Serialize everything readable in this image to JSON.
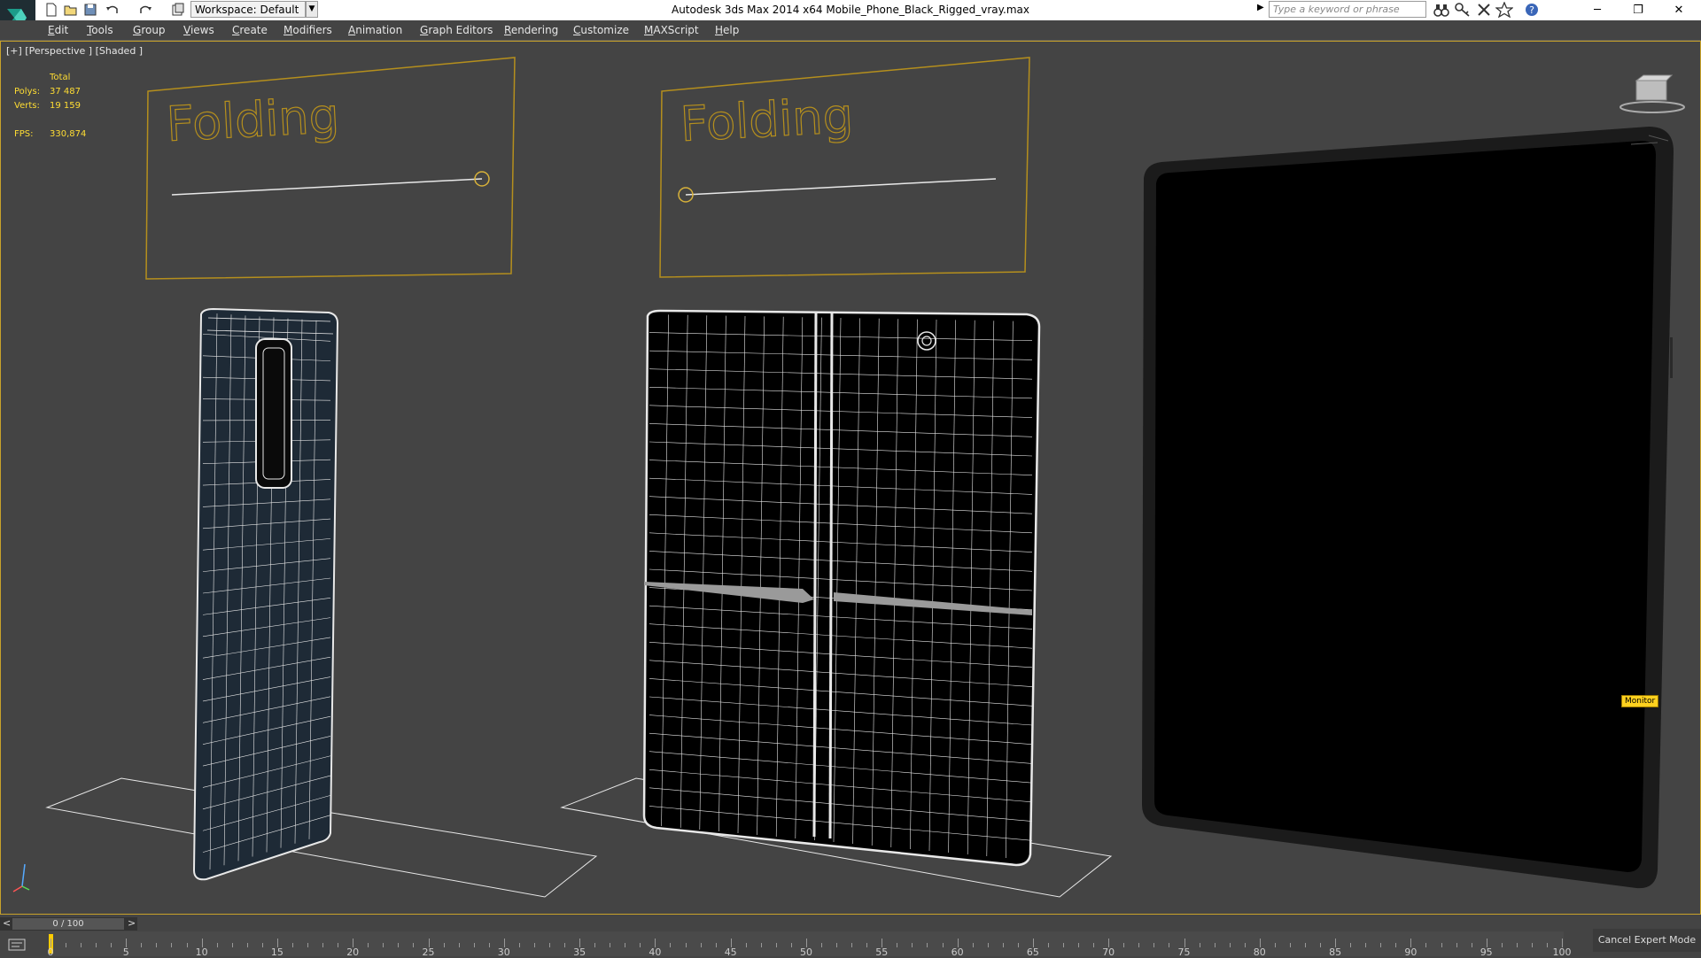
{
  "window": {
    "title": "Autodesk 3ds Max  2014 x64     Mobile_Phone_Black_Rigged_vray.max",
    "workspace": "Workspace: Default",
    "search_placeholder": "Type a keyword or phrase"
  },
  "menu": {
    "items": [
      "Edit",
      "Tools",
      "Group",
      "Views",
      "Create",
      "Modifiers",
      "Animation",
      "Graph Editors",
      "Rendering",
      "Customize",
      "MAXScript",
      "Help"
    ]
  },
  "viewport": {
    "label": "[+] [Perspective ] [Shaded ]",
    "stats": {
      "header": "Total",
      "polys_label": "Polys:",
      "polys_value": "37 487",
      "verts_label": "Verts:",
      "verts_value": "19 159",
      "fps_label": "FPS:",
      "fps_value": "330,874"
    },
    "panel_left_text": "Folding",
    "panel_mid_text": "Folding",
    "monitor_tag": "Monitor",
    "folding_slider_left": 1.0,
    "folding_slider_mid": 0.0
  },
  "timeline": {
    "frame_display": "0 / 100",
    "prev": "<",
    "next": ">",
    "ticks": [
      "0",
      "5",
      "10",
      "15",
      "20",
      "25",
      "30",
      "35",
      "40",
      "45",
      "50",
      "55",
      "60",
      "65",
      "70",
      "75",
      "80",
      "85",
      "90",
      "95",
      "100"
    ],
    "cancel_expert": "Cancel Expert Mode"
  },
  "colors": {
    "viewport_bg": "#444444",
    "panel_line": "#b58f1d",
    "wire": "#e8e8e8",
    "stats": "#ffdd33",
    "accent_yellow": "#ffd21f"
  },
  "icons": [
    "app-logo-icon",
    "new-file-icon",
    "open-file-icon",
    "save-icon",
    "undo-icon",
    "redo-icon",
    "project-icon",
    "search-arrow-icon",
    "binoculars-icon",
    "key-icon",
    "x-icon",
    "star-icon",
    "help-icon",
    "minimize-icon",
    "restore-icon",
    "close-icon",
    "viewcube-icon",
    "axis-tripod-icon",
    "track-icon"
  ]
}
